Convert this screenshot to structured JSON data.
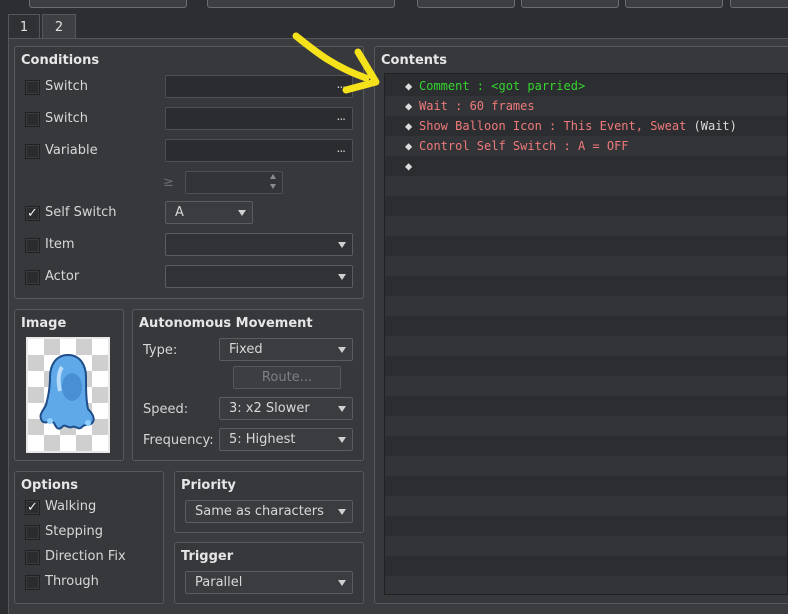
{
  "tabs": [
    {
      "label": "1",
      "active": false
    },
    {
      "label": "2",
      "active": true
    }
  ],
  "conditions": {
    "title": "Conditions",
    "switch1": {
      "label": "Switch",
      "checked": false,
      "value": "",
      "button": "..."
    },
    "switch2": {
      "label": "Switch",
      "checked": false,
      "value": "",
      "button": "..."
    },
    "variable": {
      "label": "Variable",
      "checked": false,
      "value": "",
      "button": "...",
      "operator": "≥",
      "amount": ""
    },
    "self_switch": {
      "label": "Self Switch",
      "checked": true,
      "check_glyph": "✓",
      "value": "A"
    },
    "item": {
      "label": "Item",
      "checked": false,
      "value": ""
    },
    "actor": {
      "label": "Actor",
      "checked": false,
      "value": ""
    }
  },
  "image": {
    "title": "Image",
    "sprite": "blue slime jellyfish ghost"
  },
  "autonomous": {
    "title": "Autonomous Movement",
    "type_label": "Type:",
    "type_value": "Fixed",
    "route_button": "Route...",
    "speed_label": "Speed:",
    "speed_value": "3: x2 Slower",
    "frequency_label": "Frequency:",
    "frequency_value": "5: Highest"
  },
  "options": {
    "title": "Options",
    "walking": {
      "label": "Walking",
      "checked": true,
      "check_glyph": "✓"
    },
    "stepping": {
      "label": "Stepping",
      "checked": false
    },
    "direction_fix": {
      "label": "Direction Fix",
      "checked": false
    },
    "through": {
      "label": "Through",
      "checked": false
    }
  },
  "priority": {
    "title": "Priority",
    "value": "Same as characters"
  },
  "trigger": {
    "title": "Trigger",
    "value": "Parallel"
  },
  "contents": {
    "title": "Contents",
    "bullet": "◆",
    "commands": [
      {
        "label": "Comment : <got parried>",
        "color": "#34d62e"
      },
      {
        "label": "Wait : 60 frames",
        "color": "#f07a7a"
      },
      {
        "label": "Show Balloon Icon : This Event, Sweat",
        "suffix": " (Wait)",
        "color": "#f07a7a"
      },
      {
        "label": "Control Self Switch : A = OFF",
        "color": "#f07a7a"
      },
      {
        "label": "",
        "color": "#dcdcdc"
      }
    ]
  },
  "annotation": {
    "color": "#f5e21a",
    "type": "curved-arrow"
  }
}
